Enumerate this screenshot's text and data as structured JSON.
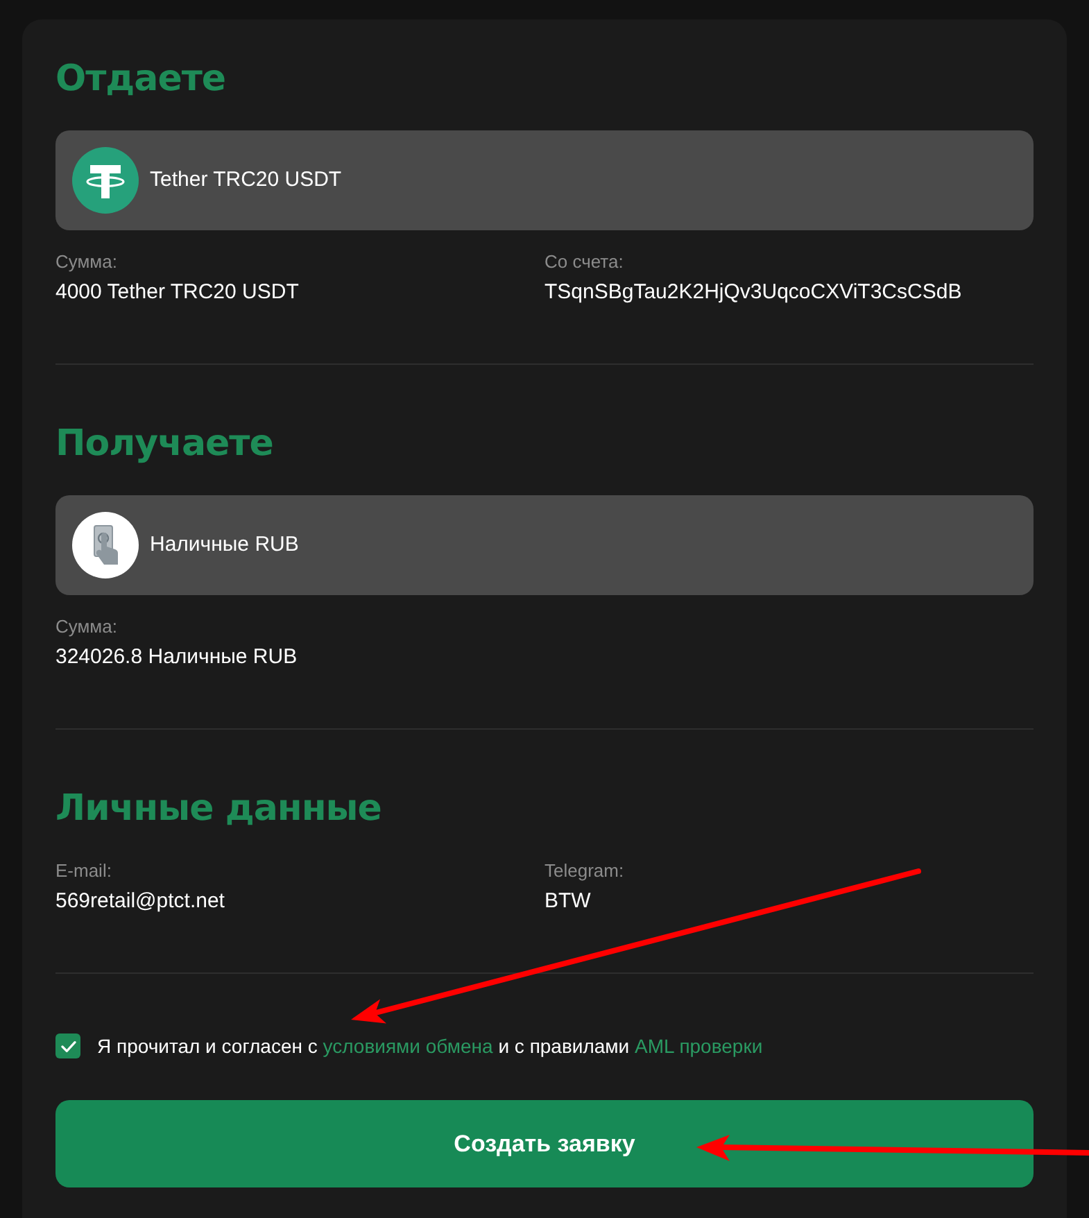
{
  "sections": [
    {
      "title": "Отдаете",
      "currency": "Tether TRC20 USDT",
      "fields": [
        {
          "label": "Сумма:",
          "value": "4000 Tether TRC20 USDT"
        },
        {
          "label": "Со счета:",
          "value": "TSqnSBgTau2K2HjQv3UqcoCXViT3CsCSdB"
        }
      ]
    },
    {
      "title": "Получаете",
      "currency": "Наличные RUB",
      "fields": [
        {
          "label": "Сумма:",
          "value": "324026.8 Наличные RUB"
        }
      ]
    },
    {
      "title": "Личные данные",
      "fields": [
        {
          "label": "E-mail:",
          "value": "569retail@ptct.net"
        },
        {
          "label": "Telegram:",
          "value": "BTW"
        }
      ]
    }
  ],
  "agreement": {
    "checked": true,
    "parts": [
      {
        "kind": "text",
        "text": "Я прочитал и согласен с "
      },
      {
        "kind": "link",
        "text": "условиями обмена"
      },
      {
        "kind": "text",
        "text": " и с правилами "
      },
      {
        "kind": "link",
        "text": "AML проверки"
      }
    ]
  },
  "submit_button": "Создать заявку"
}
